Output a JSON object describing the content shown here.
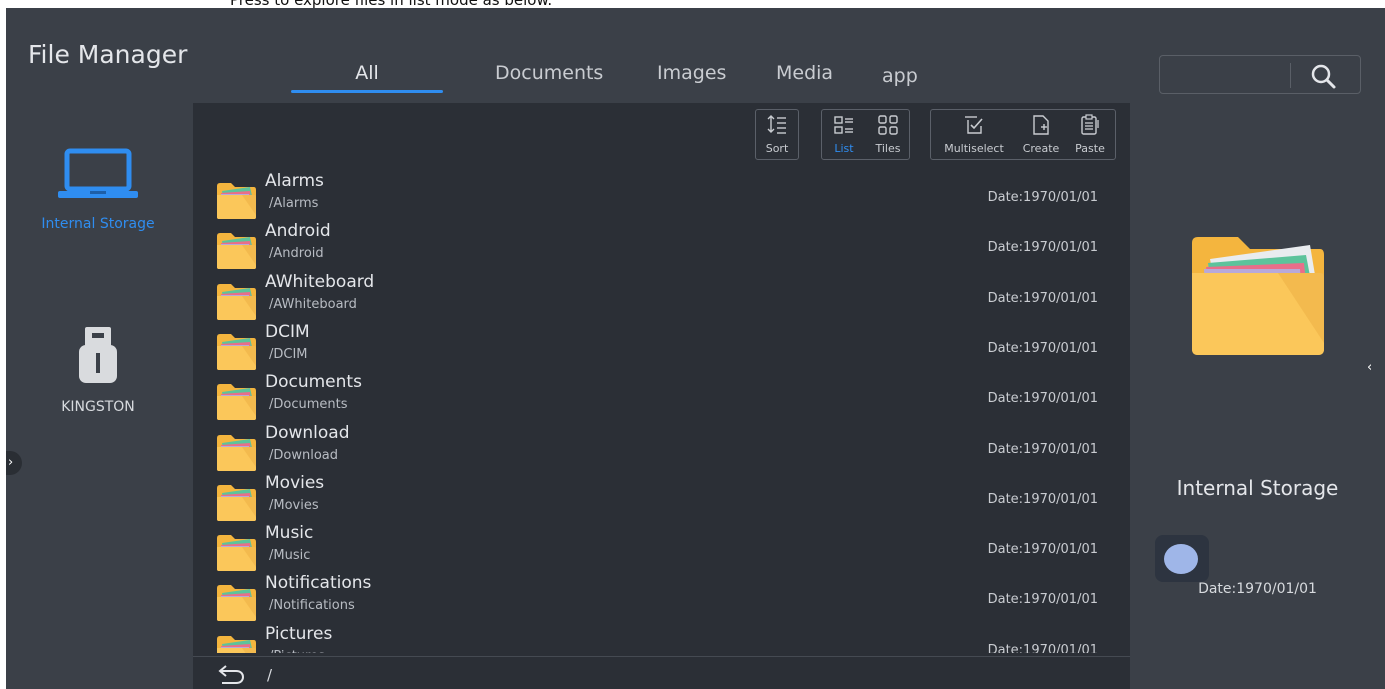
{
  "caption": {
    "text": "Press       to explore files in list mode as below."
  },
  "header": {
    "title": "File Manager",
    "tabs": [
      {
        "label": "All",
        "active": true
      },
      {
        "label": "Documents",
        "active": false
      },
      {
        "label": "Images",
        "active": false
      },
      {
        "label": "Media",
        "active": false
      },
      {
        "label": "app",
        "active": false
      }
    ],
    "search": {
      "placeholder": "",
      "icon": "search-icon"
    }
  },
  "sidebar": {
    "items": [
      {
        "label": "Internal Storage",
        "icon": "laptop-icon",
        "active": true
      },
      {
        "label": "KINGSTON",
        "icon": "usb-drive-icon",
        "active": false
      }
    ]
  },
  "toolbar": {
    "sort_label": "Sort",
    "list_label": "List",
    "tiles_label": "Tiles",
    "multiselect_label": "Multiselect",
    "create_label": "Create",
    "paste_label": "Paste",
    "view_mode": "List"
  },
  "files": [
    {
      "name": "Alarms",
      "path": "/Alarms",
      "date": "Date:1970/01/01"
    },
    {
      "name": "Android",
      "path": "/Android",
      "date": "Date:1970/01/01"
    },
    {
      "name": "AWhiteboard",
      "path": "/AWhiteboard",
      "date": "Date:1970/01/01"
    },
    {
      "name": "DCIM",
      "path": "/DCIM",
      "date": "Date:1970/01/01"
    },
    {
      "name": "Documents",
      "path": "/Documents",
      "date": "Date:1970/01/01"
    },
    {
      "name": "Download",
      "path": "/Download",
      "date": "Date:1970/01/01"
    },
    {
      "name": "Movies",
      "path": "/Movies",
      "date": "Date:1970/01/01"
    },
    {
      "name": "Music",
      "path": "/Music",
      "date": "Date:1970/01/01"
    },
    {
      "name": "Notifications",
      "path": "/Notifications",
      "date": "Date:1970/01/01"
    },
    {
      "name": "Pictures",
      "path": "/Pictures",
      "date": "Date:1970/01/01"
    }
  ],
  "footer": {
    "path": "/"
  },
  "preview": {
    "title": "Internal Storage",
    "date": "Date:1970/01/01"
  },
  "colors": {
    "accent": "#2f8df0",
    "background": "#3b4048",
    "list_background": "#2b2f36",
    "folder": "#fbc75a"
  }
}
